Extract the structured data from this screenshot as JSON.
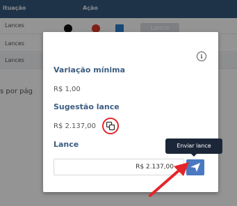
{
  "table": {
    "headers": [
      "ituação",
      "Ação"
    ],
    "rows": [
      "Lances",
      "Lances",
      "Lances"
    ],
    "lance_button": "Lance",
    "pagination_text": "s por pág",
    "icon_colors": [
      "#111111",
      "#d9382a",
      "#2b7fd1"
    ]
  },
  "modal": {
    "info_icon": "info-icon",
    "variacao_label": "Variação mínima",
    "variacao_value": "R$ 1,00",
    "sugestao_label": "Sugestão lance",
    "sugestao_value": "R$ 2.137,00",
    "copy_icon": "copy-icon",
    "lance_label": "Lance",
    "lance_input_value": "R$ 2.137,00",
    "send_icon": "send-icon",
    "tooltip": "Enviar lance"
  },
  "colors": {
    "header_bg": "#36587c",
    "label_color": "#3c5d80",
    "send_button": "#4a78c2",
    "highlight_red": "#e3252a"
  }
}
